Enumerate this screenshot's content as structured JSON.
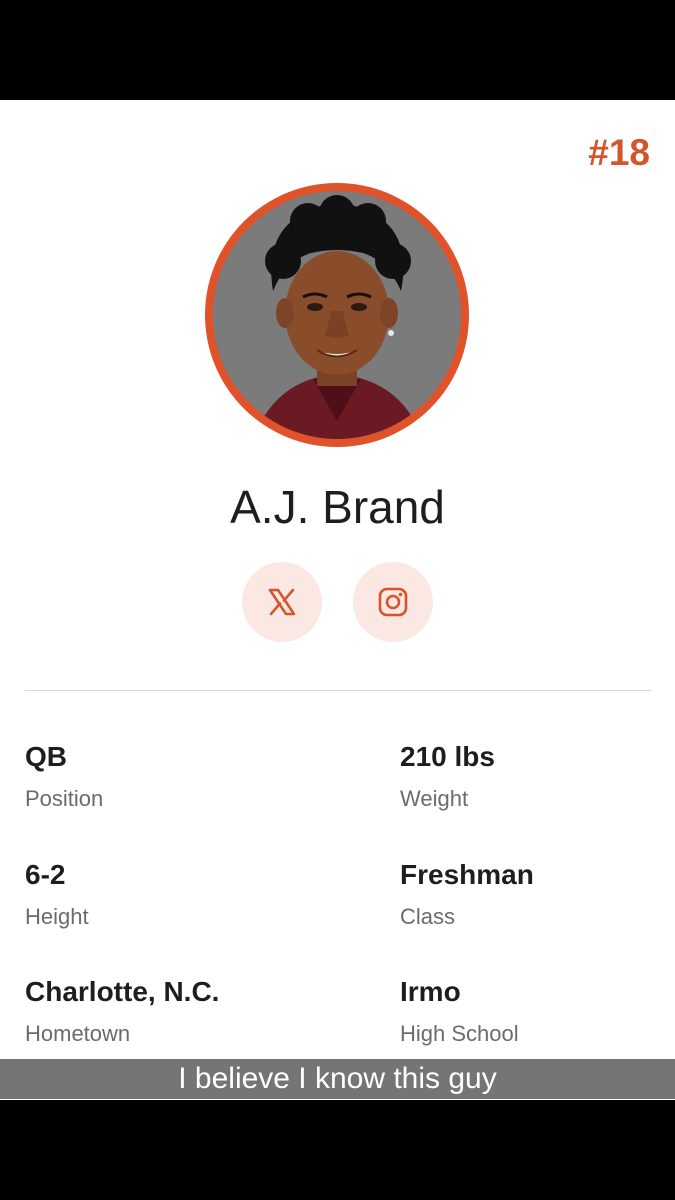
{
  "player": {
    "jersey": "#18",
    "name": "A.J. Brand",
    "photo_alt": "A.J. Brand headshot"
  },
  "social": {
    "x_icon": "x-logo-icon",
    "instagram_icon": "instagram-icon"
  },
  "stats": {
    "position": {
      "value": "QB",
      "label": "Position"
    },
    "weight": {
      "value": "210 lbs",
      "label": "Weight"
    },
    "height": {
      "value": "6-2",
      "label": "Height"
    },
    "class": {
      "value": "Freshman",
      "label": "Class"
    },
    "hometown": {
      "value": "Charlotte, N.C.",
      "label": "Hometown"
    },
    "high_school": {
      "value": "Irmo",
      "label": "High School"
    }
  },
  "caption": "I believe I know this guy",
  "colors": {
    "accent": "#d4552c",
    "social_bg": "#fbe8e2",
    "divider": "#d8d8d8"
  }
}
